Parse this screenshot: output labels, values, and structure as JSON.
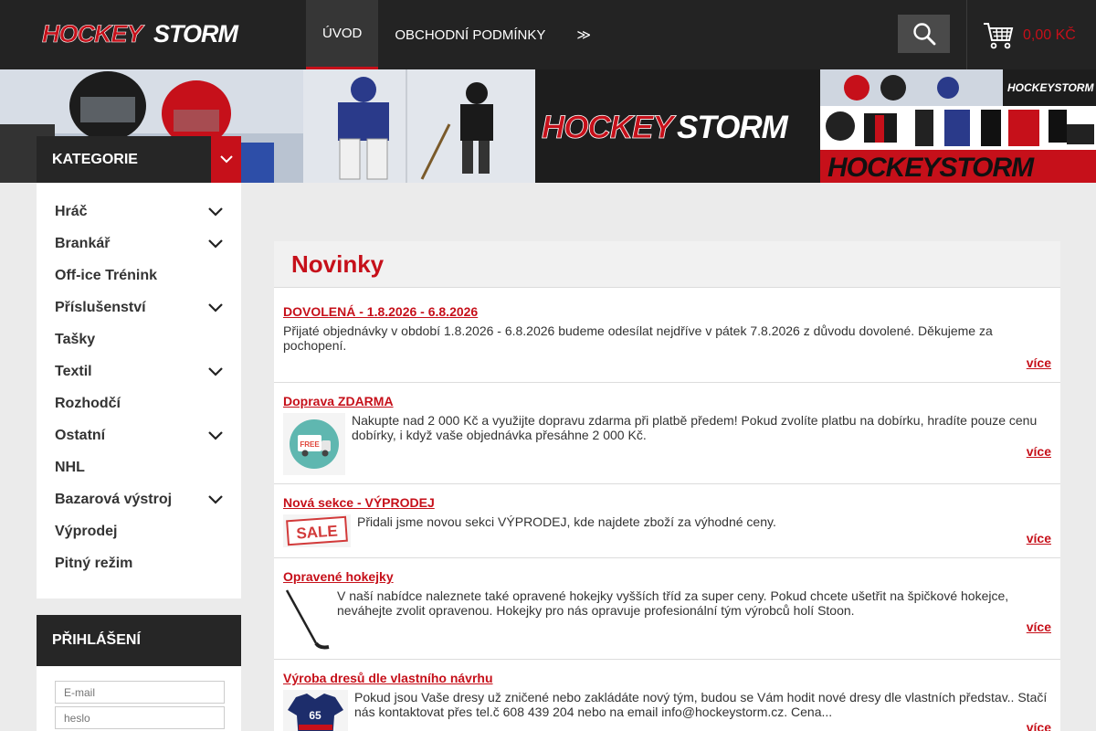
{
  "brand": {
    "logo_text": "HOCKEYSTORM",
    "accent": "#c6101a",
    "dark": "#232323"
  },
  "nav": {
    "items": [
      {
        "label": "ÚVOD",
        "active": true
      },
      {
        "label": "OBCHODNÍ PODMÍNKY",
        "active": false
      }
    ],
    "more": "≫"
  },
  "cart": {
    "price": "0,00 KČ"
  },
  "banner": {
    "logo_text": "HOCKEYSTORM"
  },
  "categories": {
    "title": "KATEGORIE",
    "items": [
      {
        "label": "Hráč",
        "expandable": true
      },
      {
        "label": "Brankář",
        "expandable": true
      },
      {
        "label": "Off-ice Trénink",
        "expandable": false
      },
      {
        "label": "Příslušenství",
        "expandable": true
      },
      {
        "label": "Tašky",
        "expandable": false
      },
      {
        "label": "Textil",
        "expandable": true
      },
      {
        "label": "Rozhodčí",
        "expandable": false
      },
      {
        "label": "Ostatní",
        "expandable": true
      },
      {
        "label": "NHL",
        "expandable": false
      },
      {
        "label": "Bazarová výstroj",
        "expandable": true
      },
      {
        "label": "Výprodej",
        "expandable": false
      },
      {
        "label": "Pitný režim",
        "expandable": false
      }
    ]
  },
  "login": {
    "title": "PŘIHLÁŠENÍ",
    "email_placeholder": "E-mail",
    "password_placeholder": "heslo"
  },
  "news": {
    "title": "Novinky",
    "more_label": "více",
    "items": [
      {
        "title": "DOVOLENÁ - 1.8.2026 - 6.8.2026",
        "text": "Přijaté objednávky v období 1.8.2026 - 6.8.2026 budeme odesílat nejdříve v pátek 7.8.2026 z důvodu dovolené.  Děkujeme za pochopení.",
        "thumb": ""
      },
      {
        "title": "Doprava ZDARMA",
        "text": "Nakupte nad 2 000 Kč a využijte dopravu zdarma při platbě předem! Pokud zvolíte platbu na dobírku, hradíte pouze cenu dobírky, i když vaše objednávka přesáhne 2 000 Kč.",
        "thumb": "free-delivery",
        "thumb_text": "FREE"
      },
      {
        "title": "Nová sekce - VÝPRODEJ",
        "text": "Přidali jsme novou sekci VÝPRODEJ, kde najdete zboží za výhodné ceny.",
        "thumb": "sale",
        "thumb_text": "SALE"
      },
      {
        "title": "Opravené hokejky",
        "text": "V naší nabídce naleznete také opravené hokejky vyšších tříd za super ceny. Pokud chcete ušetřit na špičkové hokejce, neváhejte zvolit opravenou. Hokejky pro nás opravuje profesionální tým výrobců holí Stoon.",
        "thumb": "stick"
      },
      {
        "title": "Výroba dresů dle vlastního návrhu",
        "text": "Pokud jsou Vaše dresy už zničené nebo zakládáte nový tým, budou se Vám hodit nové dresy dle vlastních představ.. Stačí nás kontaktovat přes tel.č 608 439 204 nebo na email info@hockeystorm.cz. Cena...",
        "thumb": "jersey",
        "thumb_text": "65"
      }
    ]
  }
}
